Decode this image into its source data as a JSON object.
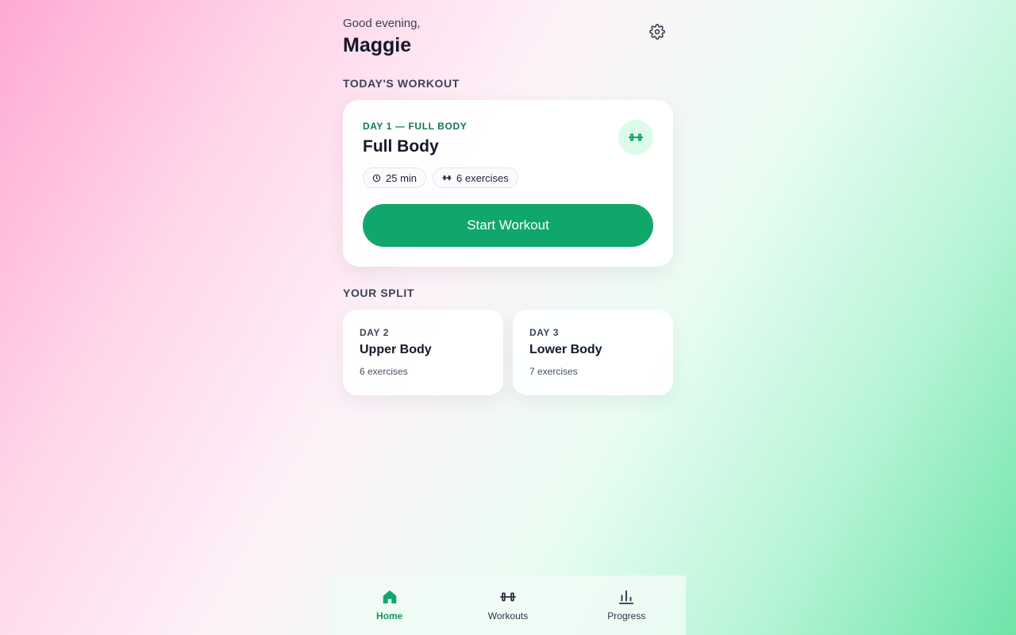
{
  "header": {
    "greeting": "Good evening,",
    "username": "Maggie"
  },
  "icons": {
    "settings": "gear-icon",
    "workout": "dumbbell-icon",
    "duration": "clock-icon",
    "exercises": "dumbbell-icon",
    "home": "home-icon",
    "workouts": "dumbbell-icon",
    "progress": "bar-chart-icon"
  },
  "today": {
    "section_title": "TODAY'S WORKOUT",
    "eyebrow": "DAY 1 — FULL BODY",
    "title": "Full Body",
    "duration": "25 min",
    "exercises": "6 exercises",
    "start_label": "Start Workout"
  },
  "split": {
    "section_title": "YOUR SPLIT",
    "days": [
      {
        "day": "DAY 2",
        "name": "Upper Body",
        "count": "6 exercises"
      },
      {
        "day": "DAY 3",
        "name": "Lower Body",
        "count": "7 exercises"
      }
    ]
  },
  "nav": {
    "items": [
      {
        "label": "Home",
        "active": true
      },
      {
        "label": "Workouts",
        "active": false
      },
      {
        "label": "Progress",
        "active": false
      }
    ]
  },
  "colors": {
    "accent": "#10a86a",
    "accent_text": "#0f7a48",
    "icon_bg": "#dcfbea"
  }
}
